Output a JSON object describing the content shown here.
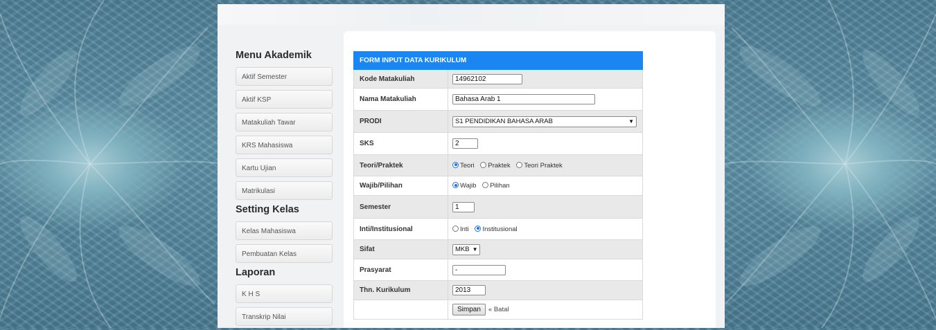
{
  "sidebar": {
    "sections": [
      {
        "title": "Menu Akademik",
        "items": [
          "Aktif Semester",
          "Aktif KSP",
          "Matakuliah Tawar",
          "KRS Mahasiswa",
          "Kartu Ujian",
          "Matrikulasi"
        ]
      },
      {
        "title": "Setting Kelas",
        "items": [
          "Kelas Mahasiswa",
          "Pembuatan Kelas"
        ]
      },
      {
        "title": "Laporan",
        "items": [
          "K H S",
          "Transkrip Nilai"
        ]
      }
    ]
  },
  "form": {
    "header": "FORM INPUT DATA KURIKULUM",
    "kode": {
      "label": "Kode Matakuliah",
      "value": "14962102"
    },
    "nama": {
      "label": "Nama Matakuliah",
      "value": "Bahasa Arab 1"
    },
    "prodi": {
      "label": "PRODI",
      "selected": "S1 PENDIDIKAN BAHASA ARAB"
    },
    "sks": {
      "label": "SKS",
      "value": "2"
    },
    "teori": {
      "label": "Teori/Praktek",
      "options": [
        "Teori",
        "Praktek",
        "Teori Praktek"
      ],
      "selected": "Teori"
    },
    "wajib": {
      "label": "Wajib/Pilihan",
      "options": [
        "Wajib",
        "Pilihan"
      ],
      "selected": "Wajib"
    },
    "semester": {
      "label": "Semester",
      "value": "1"
    },
    "inti": {
      "label": "Inti/Institusional",
      "options": [
        "Inti",
        "Institusional"
      ],
      "selected": "Institusional"
    },
    "sifat": {
      "label": "Sifat",
      "selected": "MKB"
    },
    "prasyarat": {
      "label": "Prasyarat",
      "value": "-"
    },
    "tahun": {
      "label": "Thn. Kurikulum",
      "value": "2013"
    },
    "actions": {
      "save": "Simpan",
      "cancel": "« Batal"
    }
  },
  "colors": {
    "header_bg": "#1a86f2",
    "page_bg": "#5f93a8"
  }
}
